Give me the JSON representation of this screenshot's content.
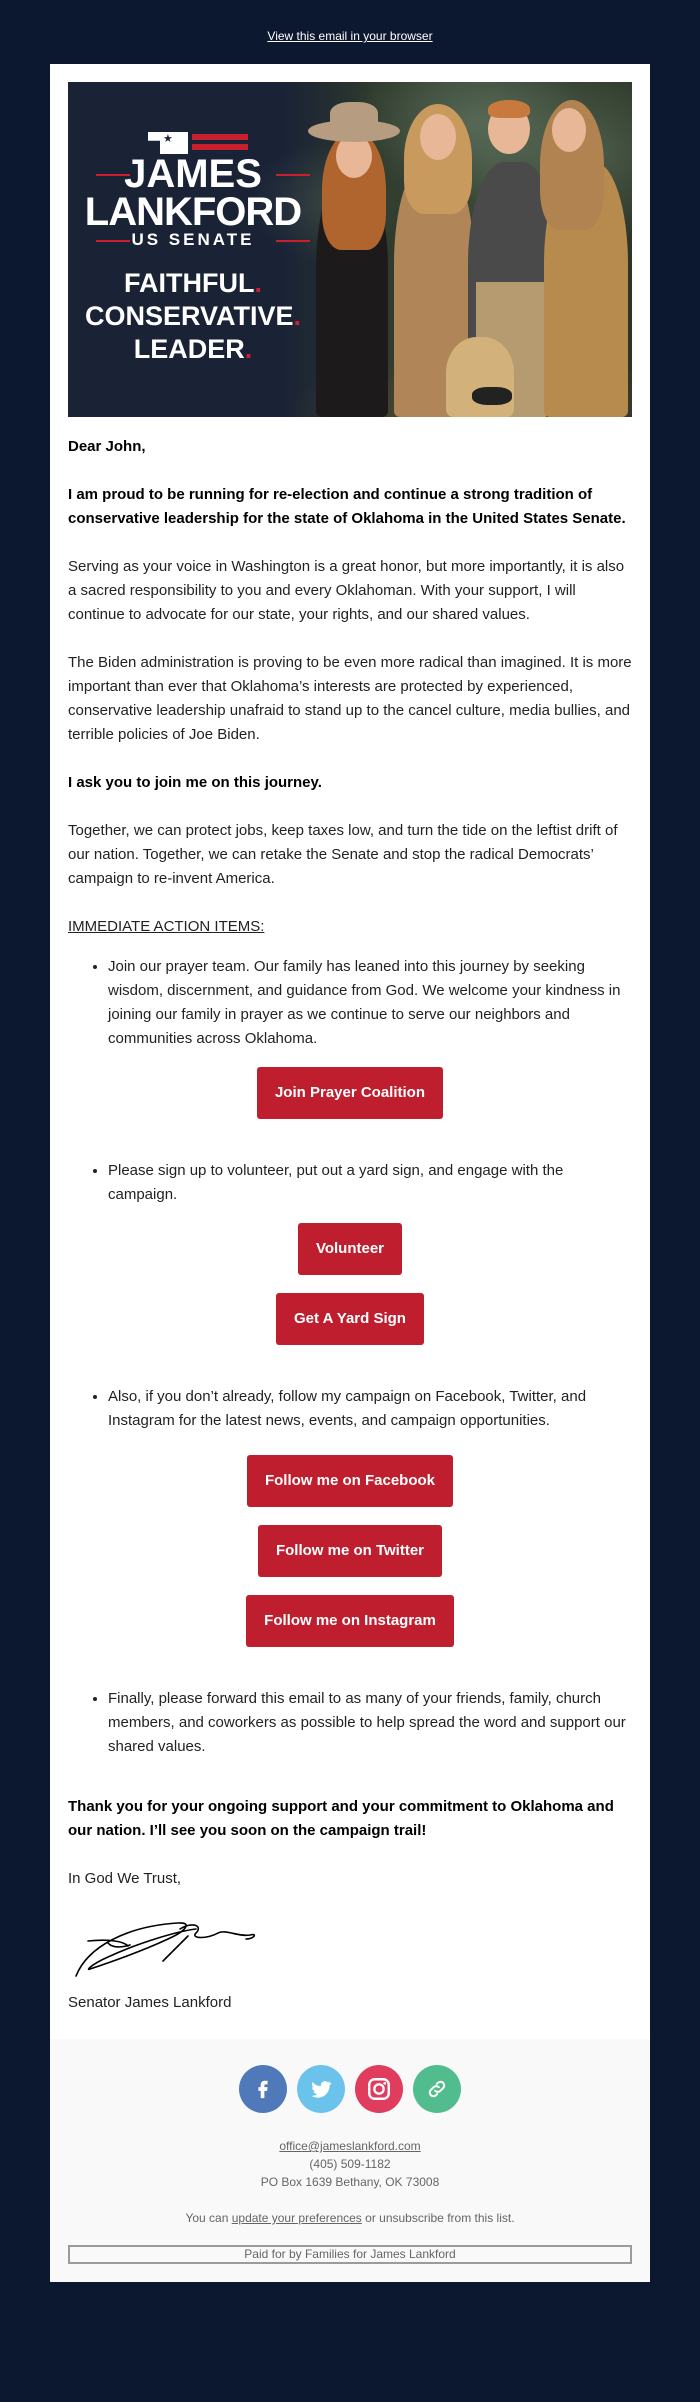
{
  "topbar": {
    "view_in_browser": "View this email in your browser"
  },
  "hero": {
    "logo": {
      "name_line1": "JAMES",
      "name_line2": "LANKFORD",
      "office": "US SENATE",
      "tagline": [
        "FAITHFUL",
        "CONSERVATIVE",
        "LEADER"
      ],
      "tagline_dot": "."
    },
    "photo_description": "Lankford family portrait with dog",
    "colors": {
      "navy": "#1a2236",
      "red": "#c8202f"
    }
  },
  "letter": {
    "salutation": "Dear John,",
    "intro_bold": "I am proud to be running for re-election and continue a strong tradition of conservative leadership for the state of Oklahoma in the United States Senate.",
    "para1": "Serving as your voice in Washington is a great honor, but more importantly, it is also a sacred responsibility to you and every Oklahoman. With your support, I will continue to advocate for our state, your rights, and our shared values.",
    "para2": "The Biden administration is proving to be even more radical than imagined. It is more important than ever that Oklahoma’s interests are protected by experienced, conservative leadership unafraid to stand up to the cancel culture, media bullies, and terrible policies of Joe Biden.",
    "ask_bold": "I ask you to join me on this journey.",
    "para3": "Together, we can protect jobs, keep taxes low, and turn the tide on the leftist drift of our nation. Together, we can retake the Senate and stop the radical Democrats’ campaign to re-invent America.",
    "action_heading": "IMMEDIATE ACTION ITEMS:",
    "actions": [
      {
        "text": "Join our prayer team.  Our family has leaned into this journey by seeking wisdom, discernment, and guidance from God.  We welcome your kindness in joining our family in prayer as we continue to serve our neighbors and communities across Oklahoma.",
        "buttons": [
          "Join Prayer Coalition"
        ]
      },
      {
        "text": "Please sign up to volunteer, put out a yard sign, and engage with the campaign.",
        "buttons": [
          "Volunteer",
          "Get A Yard Sign"
        ]
      },
      {
        "text": "Also, if you don’t already, follow my campaign on Facebook, Twitter, and Instagram for the latest news, events, and campaign opportunities.",
        "buttons": [
          "Follow me on Facebook",
          "Follow me on Twitter",
          "Follow me on Instagram"
        ]
      },
      {
        "text": "Finally, please forward this email to as many of your friends, family, church members, and coworkers as possible to help spread the word and support our shared values.",
        "buttons": []
      }
    ],
    "closing_bold": "Thank you for your ongoing support and your commitment to Oklahoma and our nation. I’ll see you soon on the campaign trail!",
    "signoff": "In God We Trust,",
    "signer": "Senator James Lankford"
  },
  "footer": {
    "social": [
      {
        "name": "facebook",
        "icon": "facebook-icon",
        "color": "#4f79b9"
      },
      {
        "name": "twitter",
        "icon": "twitter-icon",
        "color": "#6bc3ec"
      },
      {
        "name": "instagram",
        "icon": "instagram-icon",
        "color": "#e03c5d"
      },
      {
        "name": "website",
        "icon": "link-icon",
        "color": "#51bc8d"
      }
    ],
    "email": "office@jameslankford.com",
    "phone": "(405) 509-1182",
    "address": "PO Box 1639 Bethany, OK 73008",
    "prefs_prefix": "You can ",
    "prefs_link": "update your preferences",
    "prefs_suffix": " or unsubscribe from this list.",
    "paid_for": "Paid for by Families for James Lankford"
  },
  "colors": {
    "page_background": "#0c1830",
    "button_red": "#be1e2d",
    "footer_background": "#f9f9f9"
  }
}
